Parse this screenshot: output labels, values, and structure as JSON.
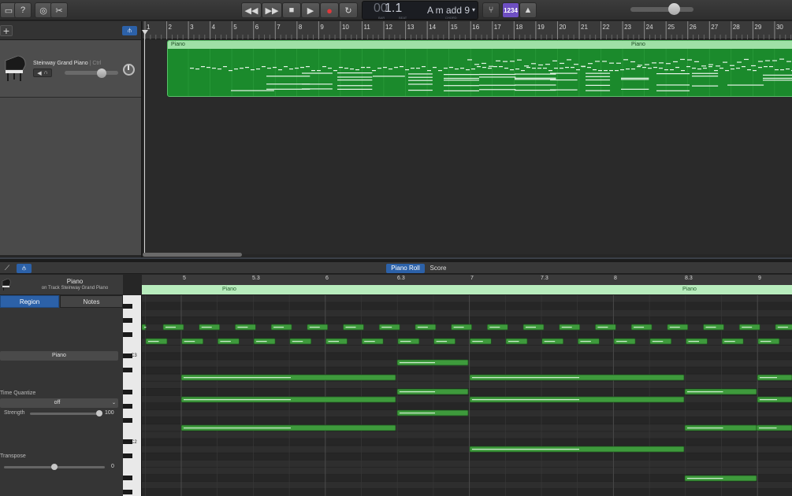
{
  "transport": {
    "lcd_bar_ghost": "00",
    "lcd_position": "1.1",
    "lcd_bar_caption": "BAR",
    "lcd_beat_caption": "BEAT",
    "lcd_chord": "A m add 9",
    "lcd_chord_caption": "CHORD",
    "count_in_label": "1234"
  },
  "tracks": {
    "ruler_numbers": [
      "1",
      "2",
      "3",
      "4",
      "5",
      "6",
      "7",
      "8",
      "9",
      "10",
      "11",
      "12",
      "13",
      "14",
      "15",
      "16",
      "17",
      "18",
      "19",
      "20",
      "21",
      "22",
      "23",
      "24",
      "25",
      "26",
      "27",
      "28",
      "29",
      "30"
    ],
    "track": {
      "name": "Steinway Grand Piano",
      "ctrl": "| Ctrl"
    },
    "region": {
      "label_left": "Piano",
      "label_right": "Piano"
    }
  },
  "editor": {
    "tab_piano_roll": "Piano Roll",
    "tab_score": "Score",
    "inspector": {
      "title": "Piano",
      "subtitle": "on Track Steinway Grand Piano",
      "tab_region": "Region",
      "tab_notes": "Notes",
      "region_name": "Piano",
      "time_quantize_label": "Time Quantize",
      "time_quantize_value": "off",
      "strength_label": "Strength",
      "strength_value": "100",
      "transpose_label": "Transpose",
      "transpose_value": "0"
    },
    "ruler_labels": [
      "5",
      "5.3",
      "6",
      "6.3",
      "7",
      "7.3",
      "8",
      "8.3",
      "9"
    ],
    "region_label_left": "Piano",
    "region_label_right": "Piano",
    "key_labels": [
      "C3",
      "C2"
    ]
  },
  "colors": {
    "accent_blue": "#2c61a8",
    "region_green": "#1b8a2c",
    "note_green": "#3e9a3c",
    "record_red": "#e0383b",
    "count_in_purple": "#6e4fc2"
  }
}
